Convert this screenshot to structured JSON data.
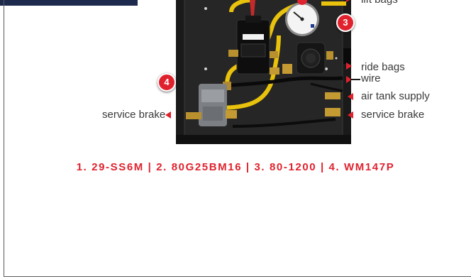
{
  "colors": {
    "accent": "#e0222e",
    "navy": "#1d2a4e",
    "text": "#3a3a3a"
  },
  "callouts": {
    "lift_bags": "lift bags",
    "ride_bags": "ride bags",
    "wire": "wire",
    "air_tank_supply": "air tank supply",
    "service_brake_left": "service brake",
    "service_brake_right": "service brake"
  },
  "badges": {
    "b3": "3",
    "b4": "4"
  },
  "part_numbers": "1. 29-SS6M | 2. 80G25BM16 | 3. 80-1200 | 4. WM147P"
}
